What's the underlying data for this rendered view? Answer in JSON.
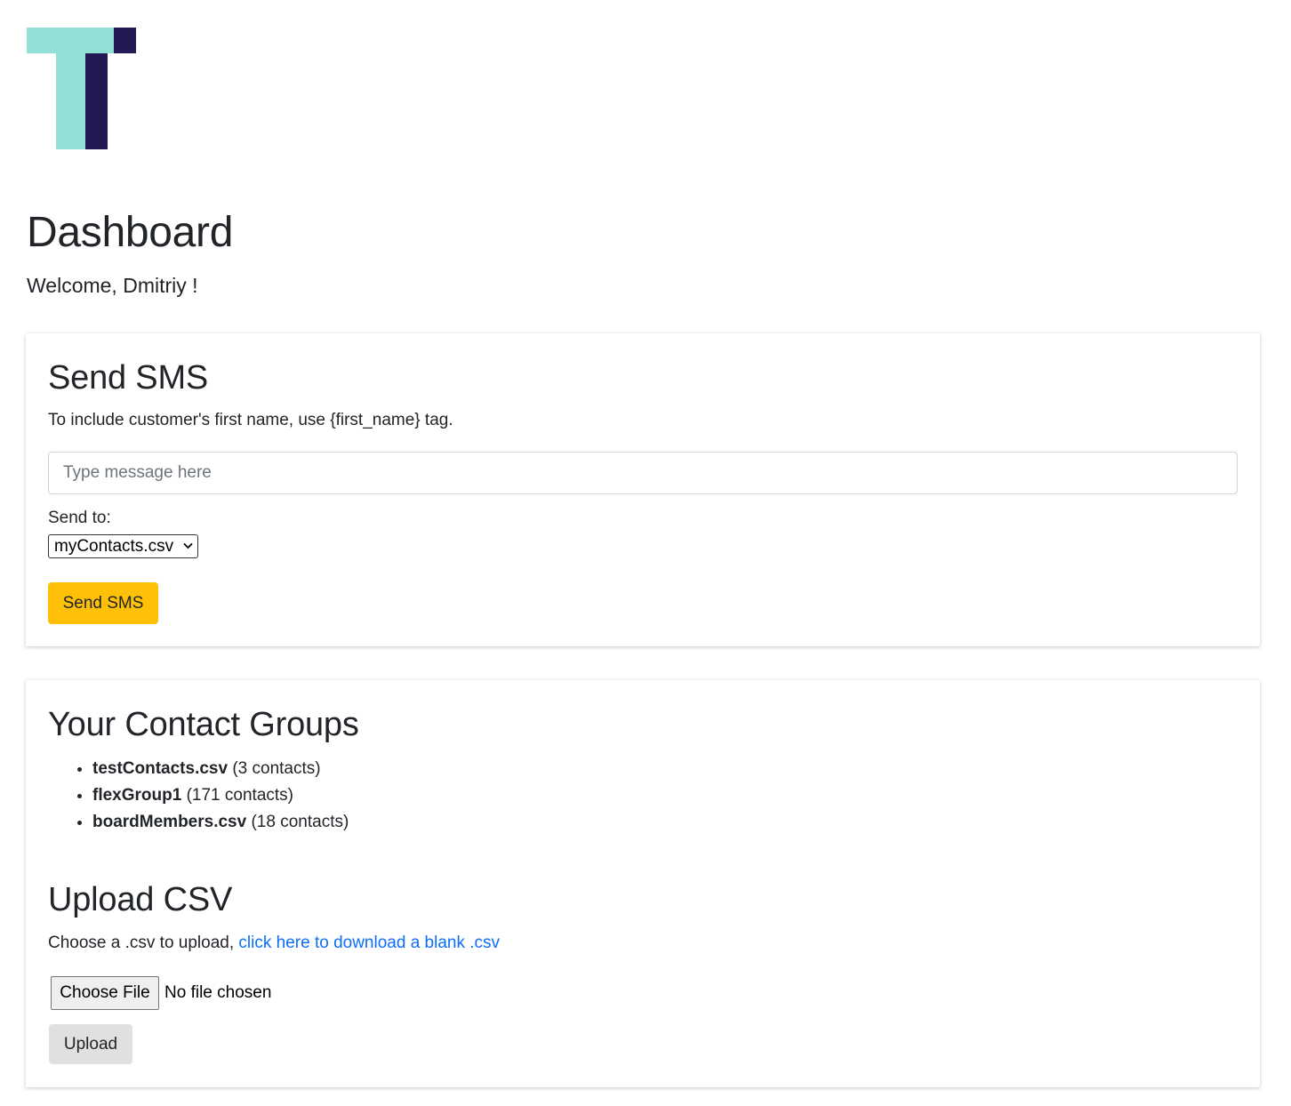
{
  "logo": {
    "icon": "brand-t-logo",
    "colors": {
      "teal": "#91e0d6",
      "navy": "#211a54"
    }
  },
  "header": {
    "title": "Dashboard",
    "welcome": "Welcome, Dmitriy !"
  },
  "send_sms": {
    "title": "Send SMS",
    "hint": "To include customer's first name, use {first_name} tag.",
    "message_placeholder": "Type message here",
    "message_value": "",
    "send_to_label": "Send to:",
    "selected_file": "myContacts.csv",
    "button_label": "Send SMS",
    "button_color": "#ffc107"
  },
  "contact_groups": {
    "title": "Your Contact Groups",
    "items": [
      {
        "name": "testContacts.csv",
        "count": "(3 contacts)"
      },
      {
        "name": "flexGroup1",
        "count": "(171 contacts)"
      },
      {
        "name": "boardMembers.csv",
        "count": "(18 contacts)"
      }
    ]
  },
  "upload": {
    "title": "Upload CSV",
    "hint_prefix": "Choose a .csv to upload,",
    "download_link": "click here to download a blank .csv",
    "choose_file_label": "Choose File",
    "file_status": "No file chosen",
    "button_label": "Upload"
  }
}
